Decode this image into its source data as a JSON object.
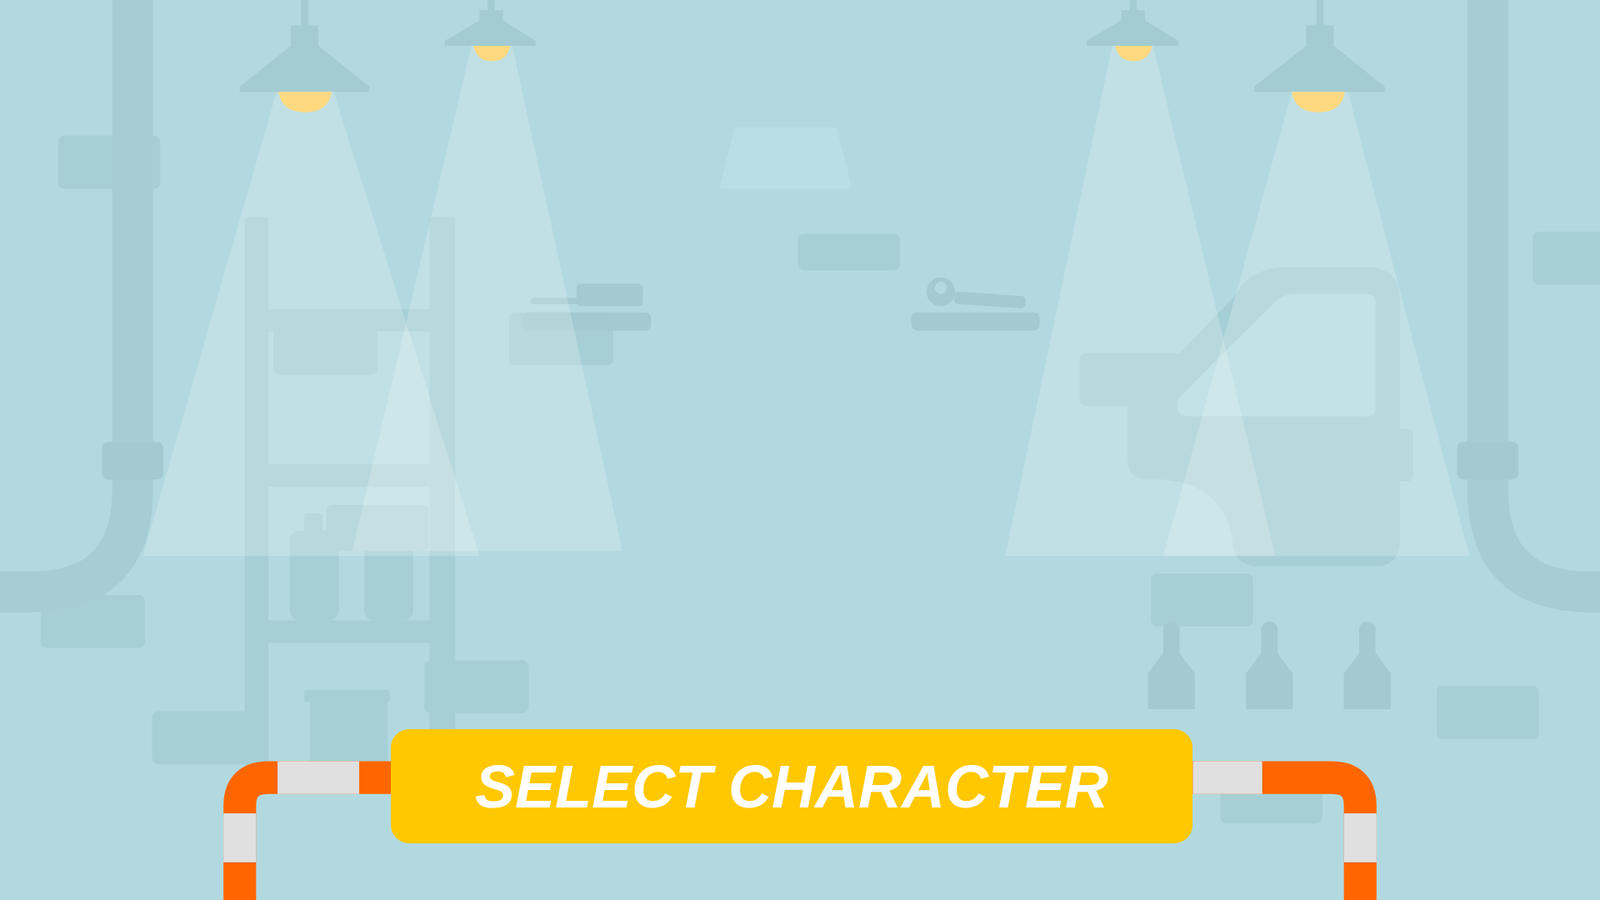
{
  "banner": {
    "title": "SELECT CHARACTER"
  }
}
